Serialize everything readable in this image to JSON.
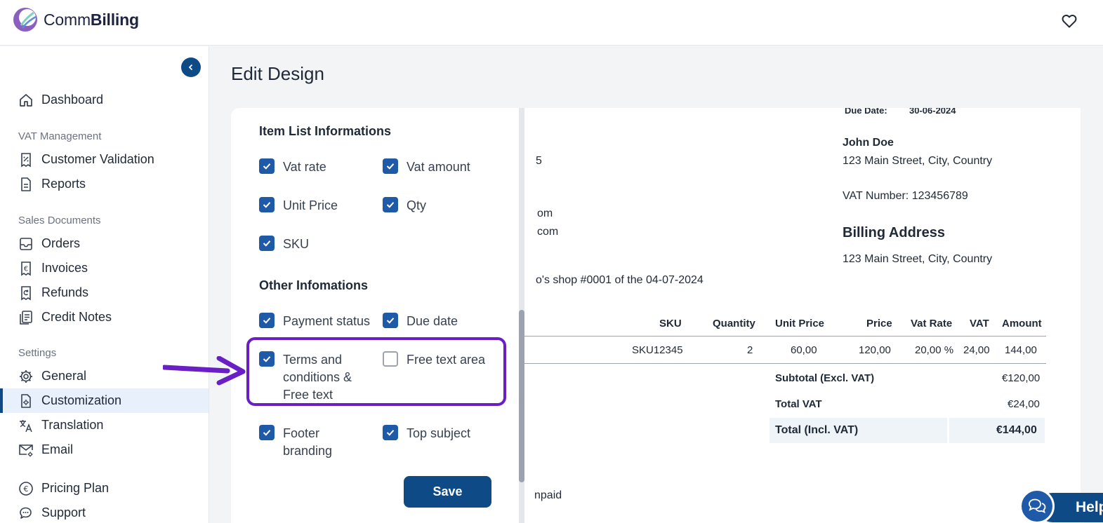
{
  "brand": {
    "name_regular": "Comm",
    "name_bold": "Billing",
    "colors": {
      "primary": "#0e4a86",
      "checkbox": "#1e5aa8",
      "highlight": "#6a1fc5"
    }
  },
  "sidebar": {
    "items": [
      {
        "label": "Dashboard",
        "icon": "home-icon"
      },
      {
        "label": "Customer Validation",
        "icon": "receipt-percent-icon"
      },
      {
        "label": "Reports",
        "icon": "document-icon"
      },
      {
        "label": "Orders",
        "icon": "inbox-icon"
      },
      {
        "label": "Invoices",
        "icon": "invoice-euro-icon"
      },
      {
        "label": "Refunds",
        "icon": "refund-icon"
      },
      {
        "label": "Credit Notes",
        "icon": "notes-icon"
      },
      {
        "label": "General",
        "icon": "gear-icon"
      },
      {
        "label": "Customization",
        "icon": "file-settings-icon"
      },
      {
        "label": "Translation",
        "icon": "translate-icon"
      },
      {
        "label": "Email",
        "icon": "mail-settings-icon"
      },
      {
        "label": "Pricing Plan",
        "icon": "euro-circle-icon"
      },
      {
        "label": "Support",
        "icon": "chat-icon"
      }
    ],
    "sections": {
      "vat": "VAT Management",
      "sales": "Sales Documents",
      "settings": "Settings"
    }
  },
  "main": {
    "title": "Edit Design",
    "item_list_heading": "Item List Informations",
    "other_heading": "Other Infomations",
    "options": {
      "vat_rate": "Vat rate",
      "vat_amount": "Vat amount",
      "unit_price": "Unit Price",
      "qty": "Qty",
      "sku": "SKU",
      "payment_status": "Payment status",
      "due_date": "Due date",
      "terms_l1": "Terms and",
      "terms_l2": "conditions &",
      "terms_l3": "Free text",
      "free_text_area": "Free text area",
      "footer_l1": "Footer",
      "footer_l2": "branding",
      "top_subject": "Top subject"
    },
    "save_label": "Save"
  },
  "preview": {
    "due_date_label": "Due Date:",
    "due_date_value": "30-06-2024",
    "customer_name": "John Doe",
    "customer_address": "123 Main Street, City, Country",
    "vat_number": "VAT Number: 123456789",
    "billing_heading": "Billing Address",
    "billing_address": "123 Main Street, City, Country",
    "frag_5": "5",
    "frag_om": "om",
    "frag_com": "com",
    "frag_shop": "o's shop #0001 of the 04-07-2024",
    "frag_paid": "npaid",
    "table": {
      "headers": [
        "SKU",
        "Quantity",
        "Unit Price",
        "Price",
        "Vat Rate",
        "VAT",
        "Amount"
      ],
      "row": [
        "SKU12345",
        "2",
        "60,00",
        "120,00",
        "20,00 %",
        "24,00",
        "144,00"
      ]
    },
    "subtotal_label": "Subtotal (Excl. VAT)",
    "subtotal_value": "€120,00",
    "total_vat_label": "Total VAT",
    "total_vat_value": "€24,00",
    "total_label": "Total (Incl. VAT)",
    "total_value": "€144,00"
  },
  "help": {
    "label": "Help"
  }
}
